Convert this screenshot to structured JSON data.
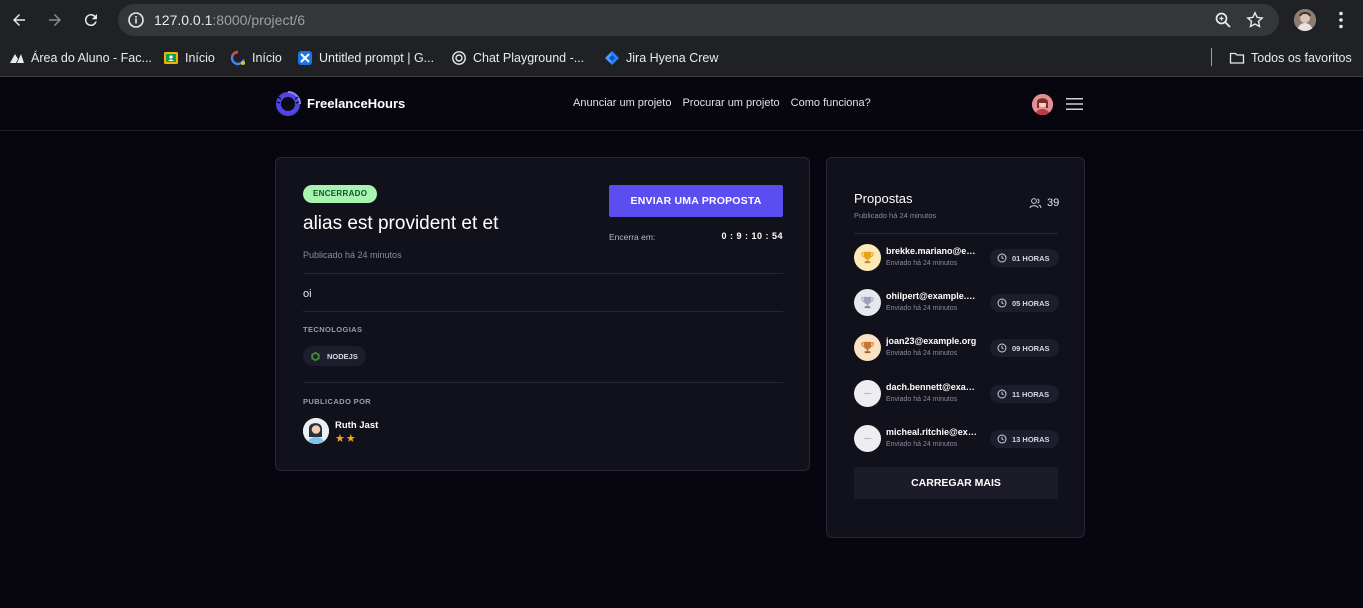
{
  "browser": {
    "url_host": "127.0.0.1",
    "url_path": ":8000/project/6",
    "bookmarks": [
      {
        "label": "Área do Aluno - Fac...",
        "icon": "a-logo-icon"
      },
      {
        "label": "Início",
        "icon": "classroom-icon"
      },
      {
        "label": "Início",
        "icon": "google-workspace-icon"
      },
      {
        "label": "Untitled prompt | G...",
        "icon": "ai-studio-icon"
      },
      {
        "label": "Chat Playground -...",
        "icon": "openai-icon"
      },
      {
        "label": "Jira Hyena Crew",
        "icon": "jira-icon"
      }
    ],
    "all_bookmarks": "Todos os favoritos"
  },
  "header": {
    "logo": "FreelanceHours",
    "links": [
      "Anunciar um projeto",
      "Procurar um projeto",
      "Como funciona?"
    ]
  },
  "project": {
    "status": "ENCERRADO",
    "title": "alias est provident et et",
    "published": "Publicado há 24 minutos",
    "send_button": "ENVIAR UMA PROPOSTA",
    "ends_label": "Encerra em:",
    "ends_value": "0 : 9 : 10 : 54",
    "description": "oi",
    "tech_label": "TECNOLOGIAS",
    "tech": "NODEJS",
    "published_by_label": "PUBLICADO POR",
    "author": "Ruth Jast",
    "author_rating": 2
  },
  "proposals": {
    "title": "Propostas",
    "subtitle": "Publicado há 24 minutos",
    "count": "39",
    "items": [
      {
        "email": "brekke.mariano@example.com",
        "time": "Enviado há 24 minutos",
        "hours": "01 HORAS",
        "trophy": "gold"
      },
      {
        "email": "ohilpert@example.com",
        "time": "Enviado há 24 minutos",
        "hours": "05 HORAS",
        "trophy": "silver"
      },
      {
        "email": "joan23@example.org",
        "time": "Enviado há 24 minutos",
        "hours": "09 HORAS",
        "trophy": "bronze"
      },
      {
        "email": "dach.bennett@example.net",
        "time": "Enviado há 24 minutos",
        "hours": "11 HORAS",
        "trophy": "none"
      },
      {
        "email": "micheal.ritchie@example.com",
        "time": "Enviado há 24 minutos",
        "hours": "13 HORAS",
        "trophy": "none"
      }
    ],
    "load_more": "CARREGAR MAIS"
  },
  "colors": {
    "accent": "#5b4ef0",
    "background": "#07060f",
    "card": "#11111b",
    "closed_badge": "#a7f3b0",
    "star": "#f5a623"
  }
}
